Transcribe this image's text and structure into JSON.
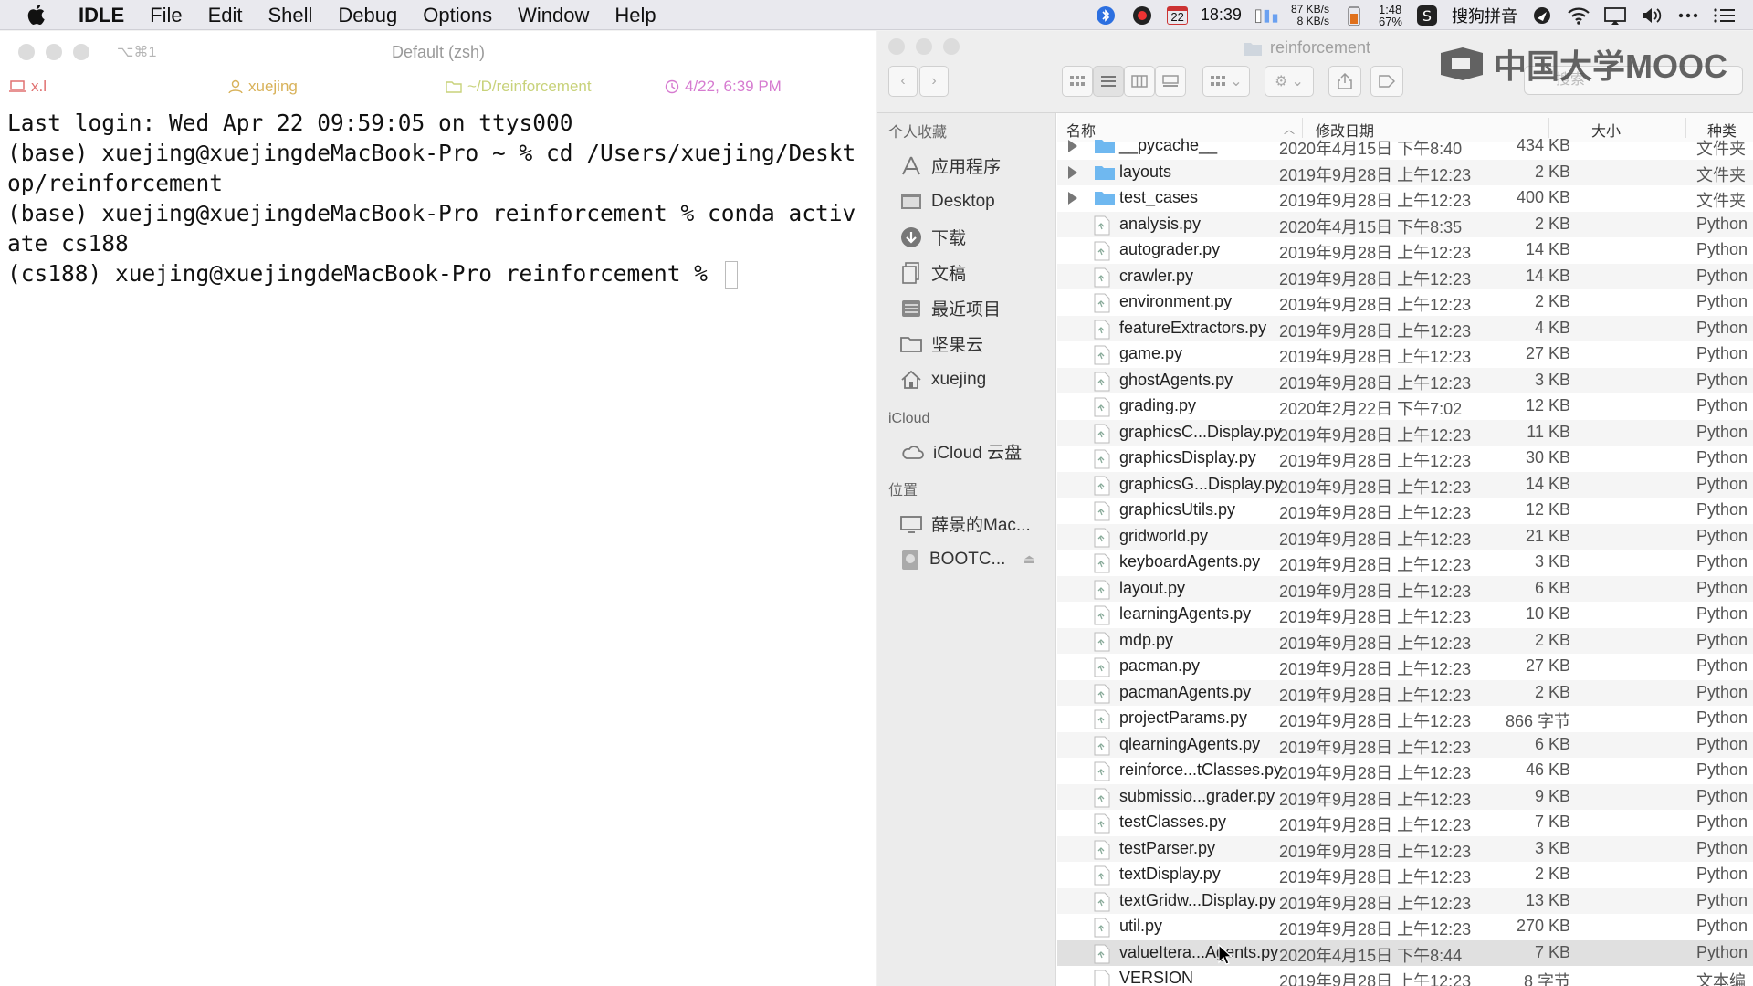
{
  "menubar": {
    "app_name": "IDLE",
    "menus": [
      "File",
      "Edit",
      "Shell",
      "Debug",
      "Options",
      "Window",
      "Help"
    ],
    "calendar_day": "22",
    "clock": "18:39",
    "net_up": "87 KB/s",
    "net_down": "8 KB/s",
    "battery_time": "1:48",
    "battery_pct": "67%",
    "ime_label": "搜狗拼音"
  },
  "terminal": {
    "shortcut": "⌥⌘1",
    "title": "Default (zsh)",
    "info_host": "x.l",
    "info_user": "xuejing",
    "info_dir": "~/D/reinforcement",
    "info_time": "4/22, 6:39 PM",
    "lines": [
      "Last login: Wed Apr 22 09:59:05 on ttys000",
      "(base) xuejing@xuejingdeMacBook-Pro ~ % cd /Users/xuejing/Deskt",
      "op/reinforcement",
      "(base) xuejing@xuejingdeMacBook-Pro reinforcement % conda activ",
      "ate cs188",
      "(cs188) xuejing@xuejingdeMacBook-Pro reinforcement % "
    ]
  },
  "finder": {
    "title": "reinforcement",
    "search_placeholder": "搜索",
    "watermark": "中国大学MOOC",
    "sidebar": {
      "favorites_header": "个人收藏",
      "favorites": [
        {
          "label": "应用程序",
          "icon": "applications-icon"
        },
        {
          "label": "Desktop",
          "icon": "desktop-folder-icon"
        },
        {
          "label": "下载",
          "icon": "downloads-icon"
        },
        {
          "label": "文稿",
          "icon": "documents-icon"
        },
        {
          "label": "最近项目",
          "icon": "recents-icon"
        },
        {
          "label": "坚果云",
          "icon": "folder-icon"
        },
        {
          "label": "xuejing",
          "icon": "home-icon"
        }
      ],
      "icloud_header": "iCloud",
      "icloud": [
        {
          "label": "iCloud 云盘",
          "icon": "cloud-icon"
        }
      ],
      "locations_header": "位置",
      "locations": [
        {
          "label": "薛景的Mac...",
          "icon": "computer-icon"
        },
        {
          "label": "BOOTC...",
          "icon": "disk-icon"
        }
      ]
    },
    "columns": {
      "name": "名称",
      "date": "修改日期",
      "size": "大小",
      "kind": "种类"
    },
    "rows": [
      {
        "name": "__pycache__",
        "date": "2020年4月15日 下午8:40",
        "size": "434 KB",
        "kind": "文件夹",
        "folder": true
      },
      {
        "name": "layouts",
        "date": "2019年9月28日 上午12:23",
        "size": "2 KB",
        "kind": "文件夹",
        "folder": true
      },
      {
        "name": "test_cases",
        "date": "2019年9月28日 上午12:23",
        "size": "400 KB",
        "kind": "文件夹",
        "folder": true
      },
      {
        "name": "analysis.py",
        "date": "2020年4月15日 下午8:35",
        "size": "2 KB",
        "kind": "Python"
      },
      {
        "name": "autograder.py",
        "date": "2019年9月28日 上午12:23",
        "size": "14 KB",
        "kind": "Python"
      },
      {
        "name": "crawler.py",
        "date": "2019年9月28日 上午12:23",
        "size": "14 KB",
        "kind": "Python"
      },
      {
        "name": "environment.py",
        "date": "2019年9月28日 上午12:23",
        "size": "2 KB",
        "kind": "Python"
      },
      {
        "name": "featureExtractors.py",
        "date": "2019年9月28日 上午12:23",
        "size": "4 KB",
        "kind": "Python"
      },
      {
        "name": "game.py",
        "date": "2019年9月28日 上午12:23",
        "size": "27 KB",
        "kind": "Python"
      },
      {
        "name": "ghostAgents.py",
        "date": "2019年9月28日 上午12:23",
        "size": "3 KB",
        "kind": "Python"
      },
      {
        "name": "grading.py",
        "date": "2020年2月22日 下午7:02",
        "size": "12 KB",
        "kind": "Python"
      },
      {
        "name": "graphicsC...Display.py",
        "date": "2019年9月28日 上午12:23",
        "size": "11 KB",
        "kind": "Python"
      },
      {
        "name": "graphicsDisplay.py",
        "date": "2019年9月28日 上午12:23",
        "size": "30 KB",
        "kind": "Python"
      },
      {
        "name": "graphicsG...Display.py",
        "date": "2019年9月28日 上午12:23",
        "size": "14 KB",
        "kind": "Python"
      },
      {
        "name": "graphicsUtils.py",
        "date": "2019年9月28日 上午12:23",
        "size": "12 KB",
        "kind": "Python"
      },
      {
        "name": "gridworld.py",
        "date": "2019年9月28日 上午12:23",
        "size": "21 KB",
        "kind": "Python"
      },
      {
        "name": "keyboardAgents.py",
        "date": "2019年9月28日 上午12:23",
        "size": "3 KB",
        "kind": "Python"
      },
      {
        "name": "layout.py",
        "date": "2019年9月28日 上午12:23",
        "size": "6 KB",
        "kind": "Python"
      },
      {
        "name": "learningAgents.py",
        "date": "2019年9月28日 上午12:23",
        "size": "10 KB",
        "kind": "Python"
      },
      {
        "name": "mdp.py",
        "date": "2019年9月28日 上午12:23",
        "size": "2 KB",
        "kind": "Python"
      },
      {
        "name": "pacman.py",
        "date": "2019年9月28日 上午12:23",
        "size": "27 KB",
        "kind": "Python"
      },
      {
        "name": "pacmanAgents.py",
        "date": "2019年9月28日 上午12:23",
        "size": "2 KB",
        "kind": "Python"
      },
      {
        "name": "projectParams.py",
        "date": "2019年9月28日 上午12:23",
        "size": "866 字节",
        "kind": "Python"
      },
      {
        "name": "qlearningAgents.py",
        "date": "2019年9月28日 上午12:23",
        "size": "6 KB",
        "kind": "Python"
      },
      {
        "name": "reinforce...tClasses.py",
        "date": "2019年9月28日 上午12:23",
        "size": "46 KB",
        "kind": "Python"
      },
      {
        "name": "submissio...grader.py",
        "date": "2019年9月28日 上午12:23",
        "size": "9 KB",
        "kind": "Python"
      },
      {
        "name": "testClasses.py",
        "date": "2019年9月28日 上午12:23",
        "size": "7 KB",
        "kind": "Python"
      },
      {
        "name": "testParser.py",
        "date": "2019年9月28日 上午12:23",
        "size": "3 KB",
        "kind": "Python"
      },
      {
        "name": "textDisplay.py",
        "date": "2019年9月28日 上午12:23",
        "size": "2 KB",
        "kind": "Python"
      },
      {
        "name": "textGridw...Display.py",
        "date": "2019年9月28日 上午12:23",
        "size": "13 KB",
        "kind": "Python"
      },
      {
        "name": "util.py",
        "date": "2019年9月28日 上午12:23",
        "size": "270 KB",
        "kind": "Python"
      },
      {
        "name": "valueItera...Agents.py",
        "date": "2020年4月15日 下午8:44",
        "size": "7 KB",
        "kind": "Python",
        "selected": true
      },
      {
        "name": "VERSION",
        "date": "2019年9月28日 上午12:23",
        "size": "8 字节",
        "kind": "文本编",
        "plain": true
      }
    ]
  },
  "colors": {
    "folder_blue": "#6fb8f0",
    "term_info_host": "#e07070",
    "term_info_user": "#d8b25a",
    "term_info_dir": "#c8d27a",
    "term_info_time": "#d67bd0"
  }
}
